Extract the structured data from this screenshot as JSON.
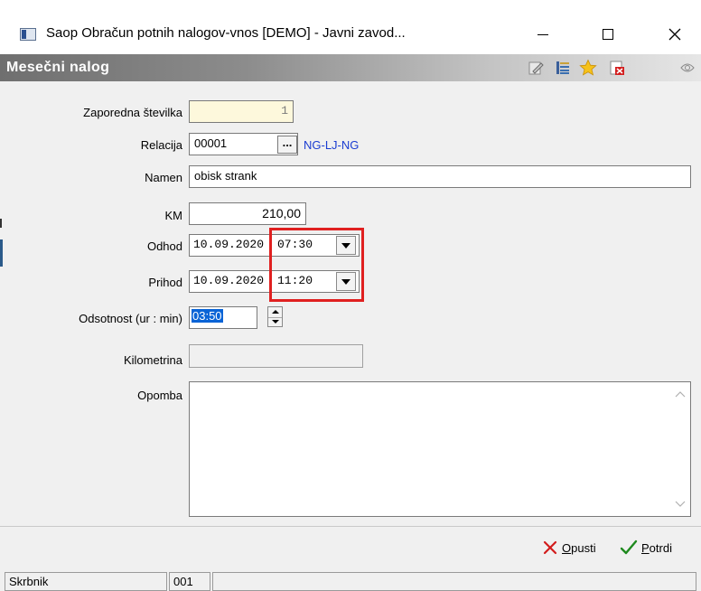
{
  "window": {
    "title": "Saop Obračun potnih nalogov-vnos [DEMO] - Javni zavod..."
  },
  "header": {
    "title": "Mesečni  nalog"
  },
  "form": {
    "zaporedna": {
      "label": "Zaporedna številka",
      "value": "1"
    },
    "relacija": {
      "label": "Relacija",
      "code": "00001",
      "browse": "...",
      "route": "NG-LJ-NG"
    },
    "namen": {
      "label": "Namen",
      "value": "obisk strank"
    },
    "km": {
      "label": "KM",
      "value": "210,00"
    },
    "odhod": {
      "label": "Odhod",
      "date": "10.09.2020",
      "time": "07:30"
    },
    "prihod": {
      "label": "Prihod",
      "date": "10.09.2020",
      "time": "11:20"
    },
    "odsotnost": {
      "label": "Odsotnost (ur : min)",
      "value": "03:50"
    },
    "kilometrina": {
      "label": "Kilometrina",
      "value": ""
    },
    "opomba": {
      "label": "Opomba",
      "value": ""
    }
  },
  "buttons": {
    "cancel": {
      "mnemonic": "O",
      "rest": "pusti"
    },
    "confirm": {
      "mnemonic": "P",
      "rest": "otrdi"
    }
  },
  "status": {
    "field": "Skrbnik",
    "value": "001"
  },
  "colors": {
    "highlight": "#e02020",
    "route_link": "#1a3cd1",
    "readonly_yellow": "#fdf8dc",
    "selection": "#0a64d6"
  }
}
